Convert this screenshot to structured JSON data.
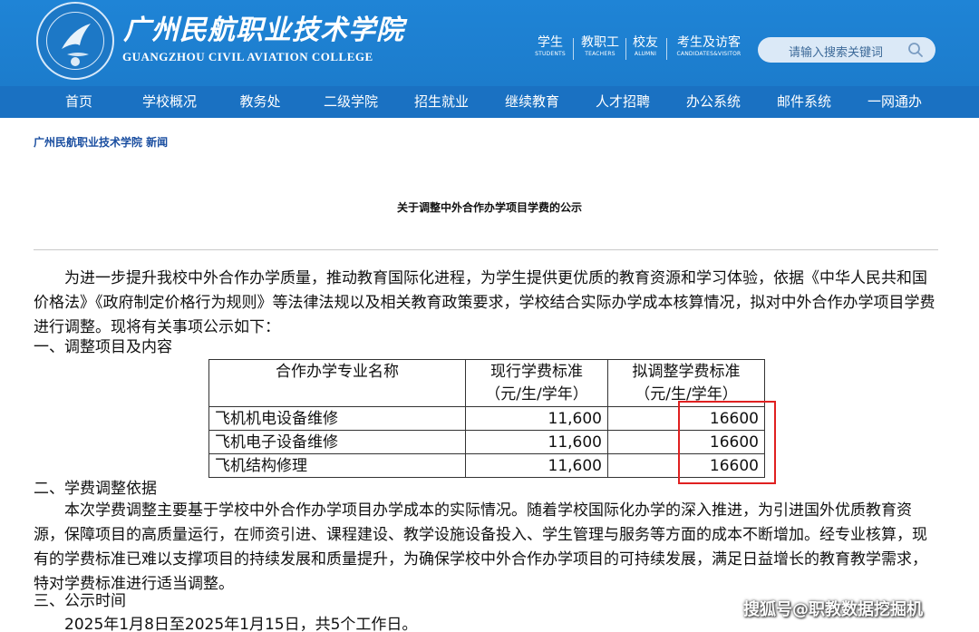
{
  "header": {
    "college_cn": "广州民航职业技术学院",
    "college_en": "GUANGZHOU CIVIL AVIATION COLLEGE",
    "quick_links": [
      {
        "cn": "学生",
        "en": "STUDENTS"
      },
      {
        "cn": "教职工",
        "en": "TEACHERS"
      },
      {
        "cn": "校友",
        "en": "ALUMNI"
      },
      {
        "cn": "考生及访客",
        "en": "CANDIDATES&VISITOR"
      }
    ],
    "search": {
      "placeholder": "请输入搜索关键词",
      "icon": "search-icon"
    },
    "colors": {
      "header_bg": "#1f84d6",
      "nav_bg": "#1a71c2"
    }
  },
  "nav": [
    "首页",
    "学校概况",
    "教务处",
    "二级学院",
    "招生就业",
    "继续教育",
    "人才招聘",
    "办公系统",
    "邮件系统",
    "一网通办"
  ],
  "breadcrumb": "广州民航职业技术学院 新闻",
  "article": {
    "title": "关于调整中外合作办学项目学费的公示",
    "intro": "为进一步提升我校中外合作办学质量，推动教育国际化进程，为学生提供更优质的教育资源和学习体验，依据《中华人民共和国价格法》《政府制定价格行为规则》等法律法规以及相关教育政策要求，学校结合实际办学成本核算情况，拟对中外合作办学项目学费进行调整。现将有关事项公示如下：",
    "section1": "一、调整项目及内容",
    "table": {
      "headers": [
        {
          "line1": "合作办学专业名称",
          "line2": ""
        },
        {
          "line1": "现行学费标准",
          "line2": "（元/生/学年）"
        },
        {
          "line1": "拟调整学费标准",
          "line2": "（元/生/学年）"
        }
      ],
      "rows": [
        {
          "name": "飞机机电设备维修",
          "current": "11,600",
          "proposed": "16600"
        },
        {
          "name": "飞机电子设备维修",
          "current": "11,600",
          "proposed": "16600"
        },
        {
          "name": "飞机结构修理",
          "current": "11,600",
          "proposed": "16600"
        }
      ]
    },
    "section2": "二、学费调整依据",
    "basis": "本次学费调整主要基于学校中外合作办学项目办学成本的实际情况。随着学校国际化办学的深入推进，为引进国外优质教育资源，保障项目的高质量运行，在师资引进、课程建设、教学设施设备投入、学生管理与服务等方面的成本不断增加。经专业核算，现有的学费标准已难以支撑项目的持续发展和质量提升，为确保学校中外合作办学项目的可持续发展，满足日益增长的教育教学需求，特对学费标准进行适当调整。",
    "section3": "三、公示时间",
    "period": "2025年1月8日至2025年1月15日，共5个工作日。"
  },
  "annotation_color": "#e02020",
  "watermark": "搜狐号@职教数据挖掘机"
}
